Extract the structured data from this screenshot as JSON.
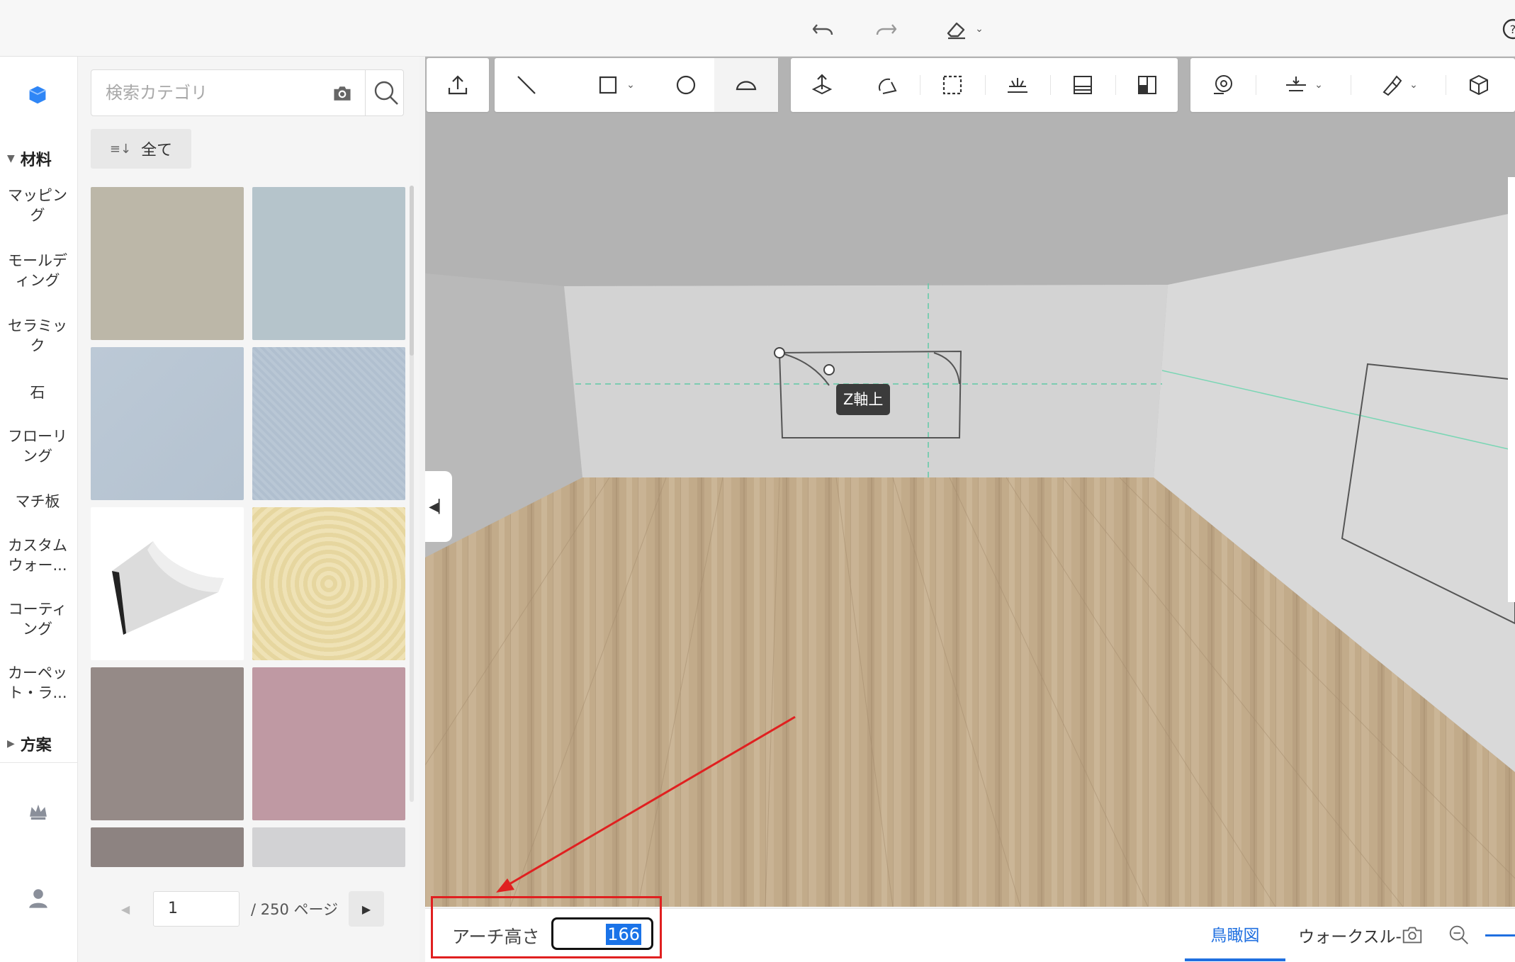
{
  "topbar": {
    "icons": [
      "undo-icon",
      "redo-icon",
      "eraser-icon",
      "help-icon"
    ]
  },
  "leftnav": {
    "section_materials": "材料",
    "items": [
      "マッピング",
      "モールディング",
      "セラミック",
      "石",
      "フローリング",
      "マチ板",
      "カスタムウォー...",
      "コーティング",
      "カーペット・ラ..."
    ],
    "section_plans": "方案"
  },
  "catalog": {
    "search_placeholder": "検索カテゴリ",
    "filter_label": "全て",
    "tiles": [
      {
        "color": "#bcb7a8"
      },
      {
        "color": "#b5c4cb"
      },
      {
        "color": "#bac7d4"
      },
      {
        "color": "#b3c1d0"
      },
      {
        "color": "#ffffff"
      },
      {
        "color": "#eadcaa"
      },
      {
        "color": "#958a87"
      },
      {
        "color": "#bf99a3"
      },
      {
        "color": "#8d8381"
      },
      {
        "color": "#d2d2d4"
      }
    ],
    "pager": {
      "current_page": "1",
      "total_label": "/ 250 ページ"
    }
  },
  "viewport": {
    "tooltip": "Z軸上"
  },
  "statusbar": {
    "arch_label": "アーチ高さ",
    "arch_value": "166",
    "tab_birdseye": "鳥瞰図",
    "tab_walkthrough": "ウォークスル-"
  },
  "colors": {
    "accent": "#1f6fe0",
    "annotation_red": "#e02020",
    "floor": "#c2ab8a",
    "wall": "#d3d3d3"
  }
}
